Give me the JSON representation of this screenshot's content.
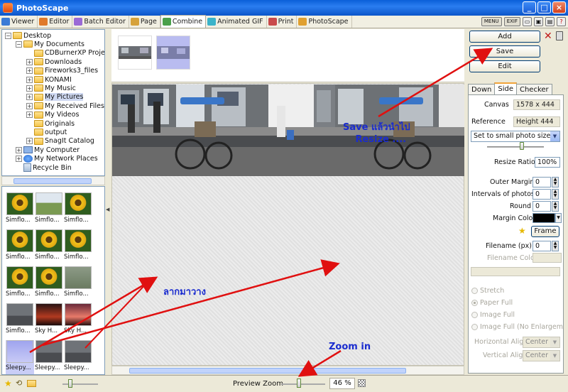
{
  "window": {
    "title": "PhotoScape",
    "min_label": "_",
    "max_label": "□",
    "close_label": "×"
  },
  "tabs": [
    {
      "label": "Viewer",
      "color": "#3b7bd6"
    },
    {
      "label": "Editor",
      "color": "#e07a2a"
    },
    {
      "label": "Batch Editor",
      "color": "#9a6ad6"
    },
    {
      "label": "Page",
      "color": "#d6a23b"
    },
    {
      "label": "Combine",
      "color": "#4aa04a"
    },
    {
      "label": "Animated GIF",
      "color": "#3bb3c9"
    },
    {
      "label": "Print",
      "color": "#c94a4a"
    },
    {
      "label": "PhotoScape",
      "color": "#e0a030"
    }
  ],
  "toolbar_right": {
    "menu_label": "MENU",
    "exif_label": "EXIF"
  },
  "tree": [
    {
      "label": "Desktop",
      "level": 0,
      "expander": "−",
      "icon": "folder"
    },
    {
      "label": "My Documents",
      "level": 1,
      "expander": "−",
      "icon": "folder"
    },
    {
      "label": "CDBurnerXP Project",
      "level": 2,
      "expander": "",
      "icon": "folder"
    },
    {
      "label": "Downloads",
      "level": 2,
      "expander": "+",
      "icon": "folder"
    },
    {
      "label": "Fireworks3_files",
      "level": 2,
      "expander": "+",
      "icon": "folder"
    },
    {
      "label": "KONAMI",
      "level": 2,
      "expander": "+",
      "icon": "folder"
    },
    {
      "label": "My Music",
      "level": 2,
      "expander": "+",
      "icon": "folder"
    },
    {
      "label": "My Pictures",
      "level": 2,
      "expander": "+",
      "icon": "folder",
      "selected": true
    },
    {
      "label": "My Received Files",
      "level": 2,
      "expander": "+",
      "icon": "folder"
    },
    {
      "label": "My Videos",
      "level": 2,
      "expander": "+",
      "icon": "folder"
    },
    {
      "label": "Originals",
      "level": 2,
      "expander": "",
      "icon": "folder"
    },
    {
      "label": "output",
      "level": 2,
      "expander": "",
      "icon": "folder"
    },
    {
      "label": "SnagIt Catalog",
      "level": 2,
      "expander": "+",
      "icon": "folder"
    },
    {
      "label": "My Computer",
      "level": 1,
      "expander": "+",
      "icon": "computer"
    },
    {
      "label": "My Network Places",
      "level": 1,
      "expander": "+",
      "icon": "network"
    },
    {
      "label": "Recycle Bin",
      "level": 1,
      "expander": "",
      "icon": "recycle"
    }
  ],
  "thumbnails": [
    {
      "caption": "Simflo...",
      "kind": "sunflower"
    },
    {
      "caption": "Simflo...",
      "kind": "field"
    },
    {
      "caption": "Simflo...",
      "kind": "sunflower"
    },
    {
      "caption": "Simflo...",
      "kind": "sunflower"
    },
    {
      "caption": "Simflo...",
      "kind": "sunflower"
    },
    {
      "caption": "Simflo...",
      "kind": "sunflower"
    },
    {
      "caption": "Simflo...",
      "kind": "sunflower"
    },
    {
      "caption": "Simflo...",
      "kind": "sunflower"
    },
    {
      "caption": "Simflo...",
      "kind": "grass"
    },
    {
      "caption": "Simflo...",
      "kind": "street"
    },
    {
      "caption": "Sky H...",
      "kind": "sunset"
    },
    {
      "caption": "Sky H...",
      "kind": "sunset2"
    },
    {
      "caption": "Sleepy...",
      "kind": "selected"
    },
    {
      "caption": "Sleepy...",
      "kind": "street"
    },
    {
      "caption": "Sleepy...",
      "kind": "street"
    }
  ],
  "right": {
    "add_label": "Add",
    "save_label": "Save",
    "edit_label": "Edit",
    "tabs": [
      {
        "label": "Down"
      },
      {
        "label": "Side"
      },
      {
        "label": "Checker"
      }
    ],
    "canvas_label": "Canvas",
    "canvas_value": "1578 x 444",
    "reference_label": "Reference",
    "reference_value": "Height 444",
    "size_select": "Set to small photo size",
    "resize_label": "Resize Ratio",
    "resize_value": "100%",
    "outer_margin_label": "Outer Margin",
    "outer_margin_value": "0",
    "intervals_label": "Intervals of photos",
    "intervals_value": "0",
    "round_label": "Round",
    "round_value": "0",
    "margin_color_label": "Margin Color",
    "margin_color": "#000000",
    "frame_label": "Frame",
    "filename_label": "Filename (px)",
    "filename_value": "0",
    "filename_color_label": "Filename Color",
    "radios": [
      {
        "label": "Stretch"
      },
      {
        "label": "Paper Full"
      },
      {
        "label": "Image Full"
      },
      {
        "label": "Image Full (No Enlargement)"
      }
    ],
    "halign_label": "Horizontal Align",
    "halign_value": "Center",
    "valign_label": "Vertical Align",
    "valign_value": "Center"
  },
  "status": {
    "preview_zoom_label": "Preview Zoom",
    "zoom_value": "46 %"
  },
  "annotations": {
    "save_line1": "Save แล้วนำไป",
    "save_line2": "Resize ....",
    "drag": "ลากมาวาง",
    "zoom": "Zoom in",
    "arrow_color": "#e01010",
    "text_color": "#1a2ccf"
  }
}
